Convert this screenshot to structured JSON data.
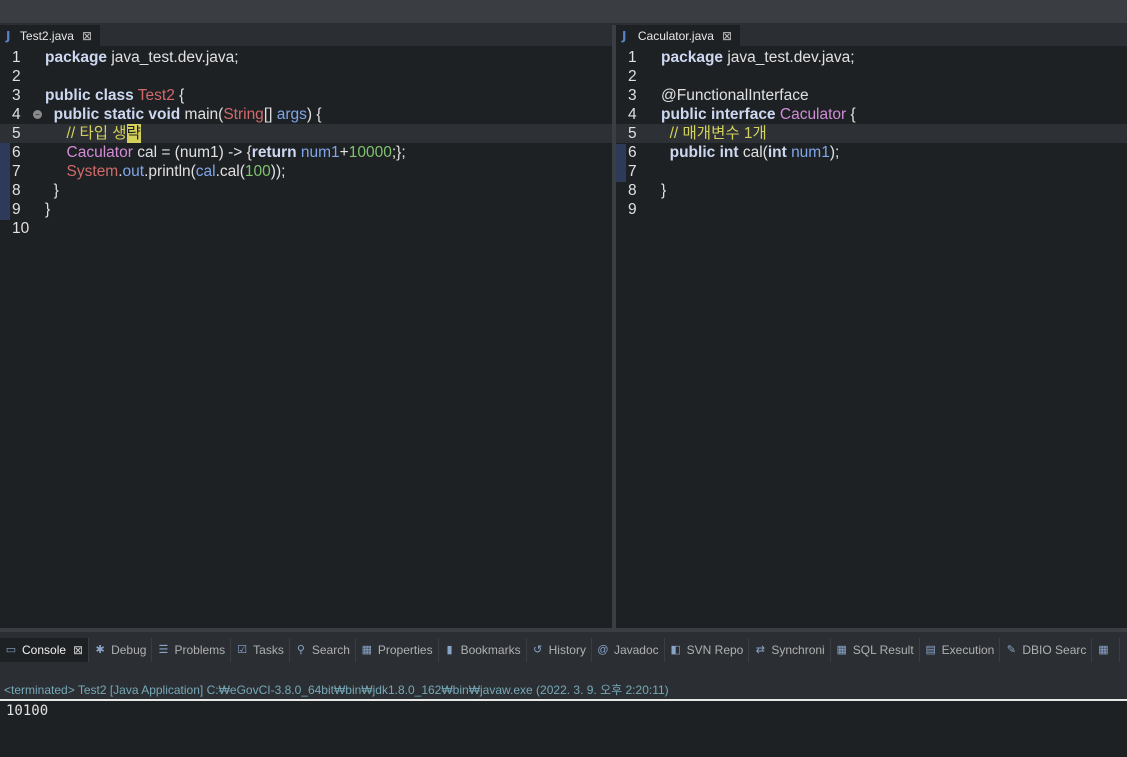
{
  "editors": [
    {
      "tab_title": "Test2.java",
      "tab_icon": "J",
      "close_glyph": "⊠",
      "lines": [
        {
          "n": "1",
          "parts": [
            [
              "kw",
              "package"
            ],
            [
              "plain",
              " java_test.dev.java;"
            ]
          ]
        },
        {
          "n": "2",
          "parts": []
        },
        {
          "n": "3",
          "parts": [
            [
              "kw",
              "public class"
            ],
            [
              "plain",
              " "
            ],
            [
              "cls",
              "Test2"
            ],
            [
              "plain",
              " {"
            ]
          ]
        },
        {
          "n": "4",
          "parts": [
            [
              "plain",
              "  "
            ],
            [
              "kw",
              "public static void"
            ],
            [
              "plain",
              " main("
            ],
            [
              "cls",
              "String"
            ],
            [
              "plain",
              "[] "
            ],
            [
              "param",
              "args"
            ],
            [
              "plain",
              ") {"
            ]
          ]
        },
        {
          "n": "5",
          "parts": [
            [
              "plain",
              "     "
            ],
            [
              "cmt",
              "// 타입 생"
            ],
            [
              "cursor",
              "략"
            ]
          ]
        },
        {
          "n": "6",
          "parts": [
            [
              "plain",
              "     "
            ],
            [
              "type2",
              "Caculator"
            ],
            [
              "plain",
              " cal = (num1) -> {"
            ],
            [
              "kw",
              "return"
            ],
            [
              "plain",
              " "
            ],
            [
              "param",
              "num1"
            ],
            [
              "plain",
              "+"
            ],
            [
              "num-lit",
              "10000"
            ],
            [
              "plain",
              ";};"
            ]
          ]
        },
        {
          "n": "7",
          "parts": [
            [
              "plain",
              "     "
            ],
            [
              "cls",
              "System"
            ],
            [
              "plain",
              "."
            ],
            [
              "param",
              "out"
            ],
            [
              "plain",
              ".println("
            ],
            [
              "param",
              "cal"
            ],
            [
              "plain",
              ".cal("
            ],
            [
              "num-lit",
              "100"
            ],
            [
              "plain",
              "));"
            ]
          ]
        },
        {
          "n": "8",
          "parts": [
            [
              "plain",
              "  }"
            ]
          ]
        },
        {
          "n": "9",
          "parts": [
            [
              "plain",
              "}"
            ]
          ]
        },
        {
          "n": "10",
          "parts": []
        }
      ]
    },
    {
      "tab_title": "Caculator.java",
      "tab_icon": "J",
      "close_glyph": "⊠",
      "lines": [
        {
          "n": "1",
          "parts": [
            [
              "kw",
              "package"
            ],
            [
              "plain",
              " java_test.dev.java;"
            ]
          ]
        },
        {
          "n": "2",
          "parts": []
        },
        {
          "n": "3",
          "parts": [
            [
              "plain",
              "@FunctionalInterface"
            ]
          ]
        },
        {
          "n": "4",
          "parts": [
            [
              "kw",
              "public interface"
            ],
            [
              "plain",
              " "
            ],
            [
              "type2",
              "Caculator"
            ],
            [
              "plain",
              " {"
            ]
          ]
        },
        {
          "n": "5",
          "parts": [
            [
              "plain",
              "  "
            ],
            [
              "cmt",
              "// 매개변수 1개"
            ]
          ]
        },
        {
          "n": "6",
          "parts": [
            [
              "plain",
              "  "
            ],
            [
              "kw",
              "public int"
            ],
            [
              "plain",
              " cal("
            ],
            [
              "kw",
              "int"
            ],
            [
              "plain",
              " "
            ],
            [
              "param",
              "num1"
            ],
            [
              "plain",
              ");"
            ]
          ]
        },
        {
          "n": "7",
          "parts": []
        },
        {
          "n": "8",
          "parts": [
            [
              "plain",
              "}"
            ]
          ]
        },
        {
          "n": "9",
          "parts": []
        }
      ]
    }
  ],
  "views": [
    {
      "label": "Console",
      "icon": "console-icon",
      "glyph": "▭",
      "active": true
    },
    {
      "label": "Debug",
      "icon": "bug-icon",
      "glyph": "✱",
      "active": false
    },
    {
      "label": "Problems",
      "icon": "problems-icon",
      "glyph": "☰",
      "active": false
    },
    {
      "label": "Tasks",
      "icon": "tasks-icon",
      "glyph": "☑",
      "active": false
    },
    {
      "label": "Search",
      "icon": "search-icon",
      "glyph": "⚲",
      "active": false
    },
    {
      "label": "Properties",
      "icon": "properties-icon",
      "glyph": "▦",
      "active": false
    },
    {
      "label": "Bookmarks",
      "icon": "bookmark-icon",
      "glyph": "▮",
      "active": false
    },
    {
      "label": "History",
      "icon": "history-icon",
      "glyph": "↺",
      "active": false
    },
    {
      "label": "Javadoc",
      "icon": "at-icon",
      "glyph": "@",
      "active": false
    },
    {
      "label": "SVN Repo",
      "icon": "svn-icon",
      "glyph": "◧",
      "active": false
    },
    {
      "label": "Synchroni",
      "icon": "sync-icon",
      "glyph": "⇄",
      "active": false
    },
    {
      "label": "SQL Result",
      "icon": "grid-icon",
      "glyph": "▦",
      "active": false
    },
    {
      "label": "Execution",
      "icon": "execution-icon",
      "glyph": "▤",
      "active": false
    },
    {
      "label": "DBIO Searc",
      "icon": "pin-icon",
      "glyph": "✎",
      "active": false
    },
    {
      "label": "",
      "icon": "grid-more-icon",
      "glyph": "▦",
      "active": false
    }
  ],
  "console": {
    "close_glyph": "⊠",
    "header": "<terminated> Test2 [Java Application] C:₩eGovCI-3.8.0_64bit₩bin₩jdk1.8.0_162₩bin₩javaw.exe (2022. 3. 9. 오후 2:20:11)",
    "output": "10100"
  }
}
